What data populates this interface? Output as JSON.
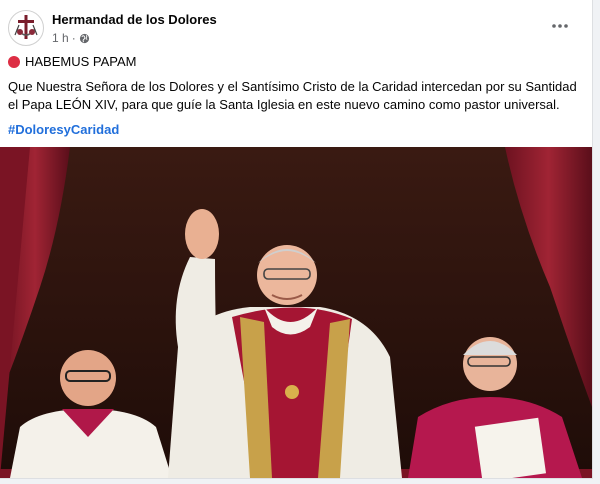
{
  "post": {
    "author": "Hermandad de los Dolores",
    "time": "1 h",
    "status_icon": "red-circle",
    "headline": "HABEMUS PAPAM",
    "body": "Que Nuestra Señora de los Dolores y el Santísimo Cristo de la Caridad intercedan por su Santidad el Papa LEÓN XIV, para que guíe la Santa Iglesia en este nuevo camino como pastor universal.",
    "hashtag": "#DoloresyCaridad"
  },
  "icons": {
    "privacy": "globe-icon",
    "more": "more-dots-icon"
  },
  "colors": {
    "hashtag": "#216fdb",
    "muted": "#65676b",
    "red_dot": "#dd2e44",
    "drape": "#8c1b2a",
    "cassock": "#b5184e"
  }
}
